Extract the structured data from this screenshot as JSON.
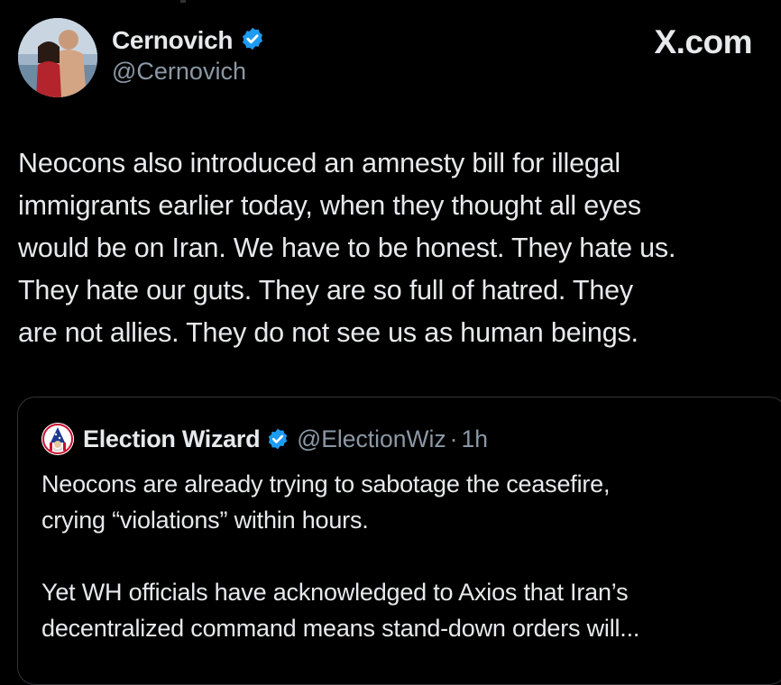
{
  "author": {
    "display_name": "Cernovich",
    "handle": "@Cernovich",
    "verified_icon": "verified-badge-icon"
  },
  "brand": "X.com",
  "tweet": {
    "lines": [
      "Neocons also introduced an amnesty bill for illegal",
      "immigrants earlier today, when they thought all eyes",
      "would be on Iran. We have to be honest. They hate us.",
      "They hate our guts. They are so full of hatred. They",
      "are not allies. They do not see us as human beings."
    ]
  },
  "quoted_tweet": {
    "display_name": "Election Wizard",
    "handle": "@ElectionWiz",
    "separator": "·",
    "time": "1h",
    "paragraph1": [
      "Neocons are already trying to sabotage the ceasefire,",
      "crying “violations” within hours."
    ],
    "paragraph2": [
      "Yet WH officials have acknowledged to Axios that Iran’s",
      "decentralized command means stand-down orders will..."
    ]
  },
  "colors": {
    "background": "#000000",
    "text": "#e7e9ea",
    "secondary_text": "#8b98a5",
    "verified_blue": "#1d9bf0",
    "border": "#2f3336"
  }
}
